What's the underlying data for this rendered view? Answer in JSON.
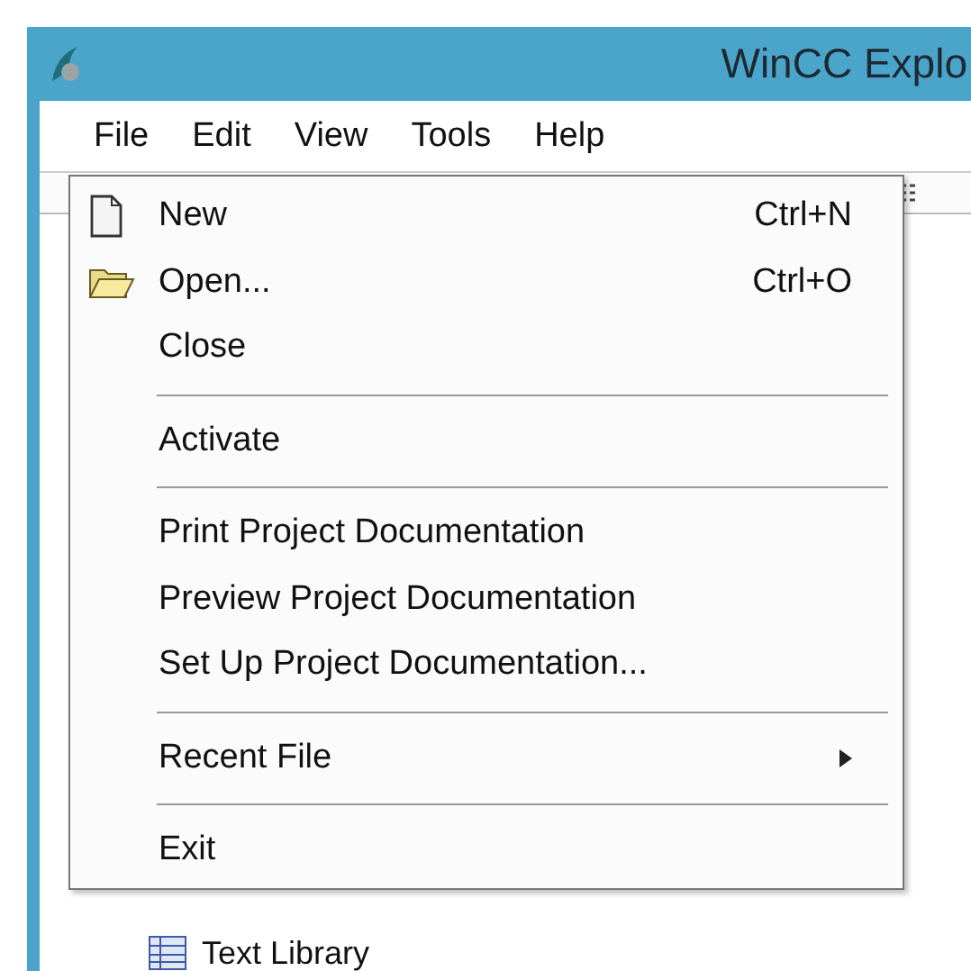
{
  "window": {
    "title": "WinCC Explo"
  },
  "menubar": [
    {
      "label": "File"
    },
    {
      "label": "Edit"
    },
    {
      "label": "View"
    },
    {
      "label": "Tools"
    },
    {
      "label": "Help"
    }
  ],
  "file_menu": [
    {
      "kind": "item",
      "label": "New",
      "shortcut": "Ctrl+N"
    },
    {
      "kind": "item",
      "label": "Open...",
      "shortcut": "Ctrl+O"
    },
    {
      "kind": "item",
      "label": "Close"
    },
    {
      "kind": "separator"
    },
    {
      "kind": "item",
      "label": "Activate"
    },
    {
      "kind": "separator"
    },
    {
      "kind": "item",
      "label": "Print Project Documentation"
    },
    {
      "kind": "item",
      "label": "Preview Project Documentation"
    },
    {
      "kind": "item",
      "label": "Set Up Project Documentation..."
    },
    {
      "kind": "separator"
    },
    {
      "kind": "submenu",
      "label": "Recent File"
    },
    {
      "kind": "separator"
    },
    {
      "kind": "item",
      "label": "Exit"
    }
  ],
  "tree": [
    {
      "label": "Text Library"
    }
  ]
}
